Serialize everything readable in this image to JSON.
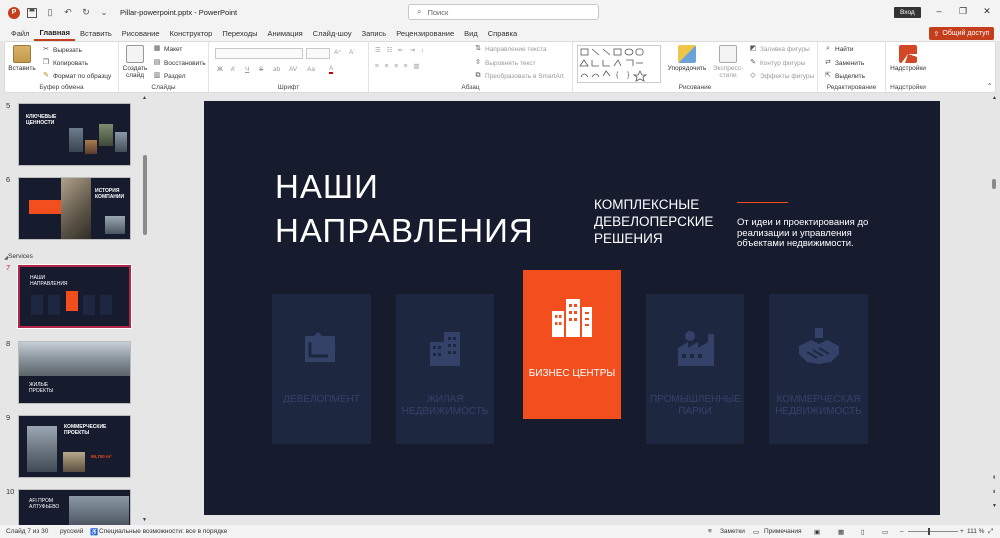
{
  "title_bar": {
    "doc_title": "Pillar-powerpoint.pptx  -  PowerPoint",
    "search_placeholder": "Поиск",
    "signin_label": "Вход"
  },
  "tabs": [
    "Файл",
    "Главная",
    "Вставить",
    "Рисование",
    "Конструктор",
    "Переходы",
    "Анимация",
    "Слайд-шоу",
    "Запись",
    "Рецензирование",
    "Вид",
    "Справка"
  ],
  "active_tab": "Главная",
  "share_label": "Общий доступ",
  "ribbon": {
    "clipboard": {
      "paste": "Вставить",
      "cut": "Вырезать",
      "copy": "Копировать",
      "format_painter": "Формат по образцу",
      "label": "Буфер обмена"
    },
    "slides": {
      "new_slide": "Создать слайд",
      "layout": "Макет",
      "reset": "Восстановить",
      "section": "Раздел",
      "label": "Слайды"
    },
    "font": {
      "label": "Шрифт",
      "bold": "Ж",
      "italic": "К",
      "underline": "Ч",
      "strike": "S",
      "shadow": "ab",
      "spacing": "AV",
      "case": "Aa"
    },
    "paragraph": {
      "label": "Абзац",
      "text_direction": "Направление текста",
      "align_text": "Выровнять текст",
      "smartart": "Преобразовать в SmartArt"
    },
    "drawing": {
      "arrange": "Упорядочить",
      "quick_styles": "Экспресс-стили",
      "fill": "Заливка фигуры",
      "outline": "Контур фигуры",
      "effects": "Эффекты фигуры",
      "label": "Рисование"
    },
    "editing": {
      "find": "Найти",
      "replace": "Заменить",
      "select": "Выделить",
      "label": "Редактирование"
    },
    "addins": {
      "button": "Надстройки",
      "label": "Надстройки"
    }
  },
  "slide_panel": {
    "section_name": "Services",
    "thumbnails": [
      {
        "number": "5",
        "title": "КЛЮЧЕВЫЕ ЦЕННОСТИ"
      },
      {
        "number": "6",
        "title": "ИСТОРИЯ КОМПАНИИ"
      },
      {
        "number": "7",
        "title": "НАШИ НАПРАВЛЕНИЯ"
      },
      {
        "number": "8",
        "title": "ЖИЛЫЕ ПРОЕКТЫ"
      },
      {
        "number": "9",
        "title": "КОММЕРЧЕСКИЕ ПРОЕКТЫ",
        "stat": "95,700 m²"
      },
      {
        "number": "10",
        "title": "AFI ПРОМ АЛТУФЬЕВО"
      }
    ]
  },
  "slide": {
    "title": "НАШИ НАПРАВЛЕНИЯ",
    "subtitle": "КОМПЛЕКСНЫЕ ДЕВЕЛОПЕРСКИЕ РЕШЕНИЯ",
    "description": "От идеи и проектирования до реализации и управления объектами недвижимости.",
    "cards": [
      {
        "label": "ДЕВЕЛОПМЕНТ",
        "icon": "blueprint-icon",
        "active": false
      },
      {
        "label": "ЖИЛАЯ НЕДВИЖИМОСТЬ",
        "icon": "apartment-building-icon",
        "active": false
      },
      {
        "label": "БИЗНЕС ЦЕНТРЫ",
        "icon": "office-towers-icon",
        "active": true
      },
      {
        "label": "ПРОМЫШЛЕННЫЕ ПАРКИ",
        "icon": "factory-icon",
        "active": false
      },
      {
        "label": "КОММЕРЧЕСКАЯ НЕДВИЖИМОСТЬ",
        "icon": "handshake-icon",
        "active": false
      }
    ]
  },
  "status_bar": {
    "slide_counter": "Слайд 7 из 30",
    "language": "русский",
    "accessibility": "Специальные возможности: все в порядке",
    "notes": "Заметки",
    "comments": "Примечания",
    "zoom": "111 %"
  },
  "colors": {
    "accent": "#f24e1e",
    "slide_bg": "#161b2e",
    "card_bg": "#1e2740",
    "brand": "#c43e1c"
  }
}
